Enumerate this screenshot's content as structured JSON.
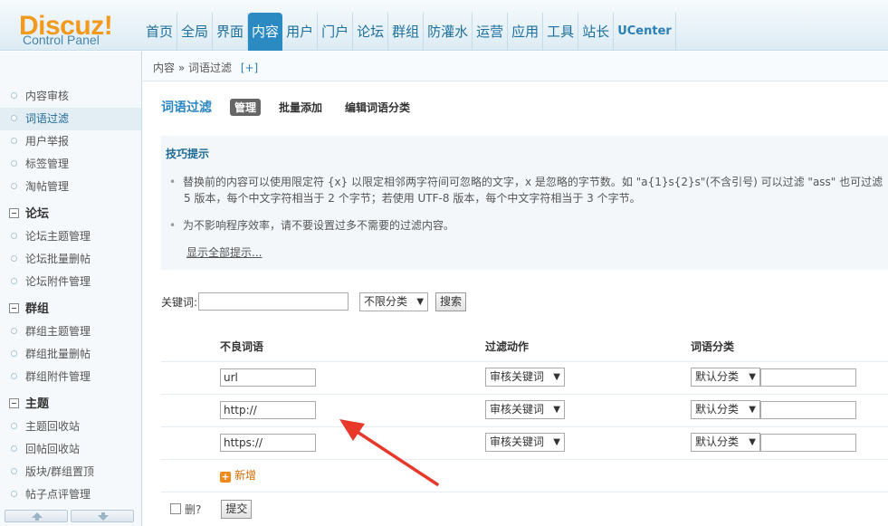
{
  "logo": {
    "main": "Discuz!",
    "sub": "Control Panel"
  },
  "nav": [
    {
      "label": "首页"
    },
    {
      "label": "全局"
    },
    {
      "label": "界面"
    },
    {
      "label": "内容",
      "active": true
    },
    {
      "label": "用户"
    },
    {
      "label": "门户"
    },
    {
      "label": "论坛"
    },
    {
      "label": "群组"
    },
    {
      "label": "防灌水"
    },
    {
      "label": "运营"
    },
    {
      "label": "应用"
    },
    {
      "label": "工具"
    },
    {
      "label": "站长"
    },
    {
      "label": "UCenter"
    }
  ],
  "sidebar": {
    "top_items": [
      "内容审核",
      "词语过滤",
      "用户举报",
      "标签管理",
      "淘帖管理"
    ],
    "groups": [
      {
        "title": "论坛",
        "items": [
          "论坛主题管理",
          "论坛批量删帖",
          "论坛附件管理"
        ]
      },
      {
        "title": "群组",
        "items": [
          "群组主题管理",
          "群组批量删帖",
          "群组附件管理"
        ]
      },
      {
        "title": "主题",
        "items": [
          "主题回收站",
          "回帖回收站",
          "版块/群组置顶",
          "帖子点评管理"
        ]
      }
    ]
  },
  "breadcrumb": {
    "path": "内容 » 词语过滤",
    "plus": "[+]"
  },
  "page": {
    "title": "词语过滤",
    "tabs": [
      {
        "label": "管理",
        "active": true
      },
      {
        "label": "批量添加"
      },
      {
        "label": "编辑词语分类"
      }
    ]
  },
  "tips": {
    "title": "技巧提示",
    "line1a": "替换前的内容可以使用限定符 {x} 以限定相邻两字符间可忽略的文字，x 是忽略的字节数。如 \"a{1}s{2}s\"(不含引号) 可以过滤 \"ass\" 也可过滤",
    "line1b": "5 版本，每个中文字符相当于 2 个字节；若使用 UTF-8 版本，每个中文字符相当于 3 个字节。",
    "line2": "为不影响程序效率，请不要设置过多不需要的过滤内容。",
    "show_all": "显示全部提示..."
  },
  "search": {
    "label": "关键词:",
    "value": "",
    "category": "不限分类",
    "button": "搜索"
  },
  "table": {
    "headers": [
      "不良词语",
      "过滤动作",
      "词语分类"
    ],
    "rows": [
      {
        "word": "url",
        "action": "审核关键词",
        "category": "默认分类"
      },
      {
        "word": "http://",
        "action": "审核关键词",
        "category": "默认分类"
      },
      {
        "word": "https://",
        "action": "审核关键词",
        "category": "默认分类"
      }
    ],
    "add_label": "新增",
    "delete_label": "删?",
    "submit": "提交"
  },
  "colors": {
    "accent": "#2c8ac3",
    "logo": "#f29a1e",
    "annotation": "#e8382a"
  }
}
